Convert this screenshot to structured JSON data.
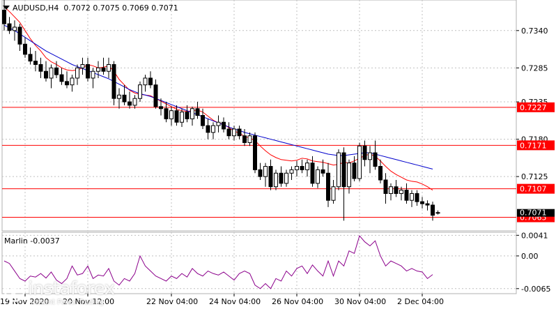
{
  "header": {
    "symbol": "AUDUSD,H4",
    "ohlc": "0.7072 0.7075 0.7069 0.7071"
  },
  "indicator": {
    "label": "Marlin -0.0037"
  },
  "logo": {
    "brand": "instaforex",
    "tagline": "Instant Forex Trading"
  },
  "colors": {
    "background": "#ffffff",
    "grid": "#c0c0c0",
    "level_line": "#ff0000",
    "ma_fast": "#ff0000",
    "ma_slow": "#0000cc",
    "oscillator": "#8b008b",
    "candle_bull": "#ffffff",
    "candle_bear": "#000000",
    "current_price_label": "#000000"
  },
  "chart_data": [
    {
      "type": "candlestick",
      "title": "AUDUSD,H4",
      "ylim": [
        0.7045,
        0.7385
      ],
      "y_ticks": [
        "0.7340",
        "0.7285",
        "0.7235",
        "0.7180",
        "0.7125"
      ],
      "x_ticks": [
        "19 Nov 2020",
        "20 Nov 12:00",
        "22 Nov 04:00",
        "24 Nov 04:00",
        "26 Nov 04:00",
        "30 Nov 04:00",
        "2 Dec 04:00"
      ],
      "grid": true,
      "levels": [
        {
          "value": 0.7227,
          "label": "0.7227"
        },
        {
          "value": 0.7171,
          "label": "0.7171"
        },
        {
          "value": 0.7107,
          "label": "0.7107"
        },
        {
          "value": 0.7065,
          "label": "0.7065"
        }
      ],
      "current_price": {
        "value": 0.7071,
        "label": "0.7071"
      },
      "candles": [
        [
          0.737,
          0.7385,
          0.734,
          0.735
        ],
        [
          0.735,
          0.736,
          0.7335,
          0.734
        ],
        [
          0.734,
          0.7355,
          0.7325,
          0.7345
        ],
        [
          0.7345,
          0.735,
          0.731,
          0.732
        ],
        [
          0.732,
          0.733,
          0.73,
          0.7305
        ],
        [
          0.7305,
          0.7315,
          0.729,
          0.7295
        ],
        [
          0.7295,
          0.731,
          0.728,
          0.729
        ],
        [
          0.729,
          0.73,
          0.727,
          0.728
        ],
        [
          0.728,
          0.7295,
          0.7265,
          0.727
        ],
        [
          0.727,
          0.729,
          0.7255,
          0.7285
        ],
        [
          0.7285,
          0.7295,
          0.727,
          0.7275
        ],
        [
          0.7275,
          0.7285,
          0.726,
          0.7265
        ],
        [
          0.7265,
          0.728,
          0.7255,
          0.726
        ],
        [
          0.726,
          0.7275,
          0.725,
          0.727
        ],
        [
          0.727,
          0.729,
          0.726,
          0.7285
        ],
        [
          0.7285,
          0.73,
          0.7275,
          0.729
        ],
        [
          0.729,
          0.73,
          0.7265,
          0.727
        ],
        [
          0.727,
          0.7285,
          0.7255,
          0.728
        ],
        [
          0.728,
          0.7295,
          0.727,
          0.7285
        ],
        [
          0.7285,
          0.73,
          0.7275,
          0.728
        ],
        [
          0.728,
          0.73,
          0.727,
          0.729
        ],
        [
          0.729,
          0.7295,
          0.723,
          0.724
        ],
        [
          0.724,
          0.7255,
          0.7225,
          0.7245
        ],
        [
          0.7245,
          0.726,
          0.723,
          0.7235
        ],
        [
          0.7235,
          0.725,
          0.7225,
          0.723
        ],
        [
          0.723,
          0.7245,
          0.7225,
          0.724
        ],
        [
          0.724,
          0.7265,
          0.7235,
          0.726
        ],
        [
          0.726,
          0.7275,
          0.725,
          0.727
        ],
        [
          0.727,
          0.728,
          0.7255,
          0.726
        ],
        [
          0.726,
          0.7268,
          0.7225,
          0.7228
        ],
        [
          0.7228,
          0.724,
          0.7215,
          0.7225
        ],
        [
          0.7225,
          0.7235,
          0.7205,
          0.721
        ],
        [
          0.721,
          0.7228,
          0.72,
          0.7222
        ],
        [
          0.7222,
          0.723,
          0.72,
          0.7205
        ],
        [
          0.7205,
          0.7225,
          0.7198,
          0.722
        ],
        [
          0.722,
          0.723,
          0.7205,
          0.721
        ],
        [
          0.721,
          0.7228,
          0.72,
          0.7225
        ],
        [
          0.7225,
          0.7235,
          0.721,
          0.7215
        ],
        [
          0.7215,
          0.7225,
          0.7195,
          0.72
        ],
        [
          0.72,
          0.721,
          0.718,
          0.719
        ],
        [
          0.719,
          0.7205,
          0.718,
          0.72
        ],
        [
          0.72,
          0.7215,
          0.719,
          0.7205
        ],
        [
          0.7205,
          0.7212,
          0.719,
          0.7195
        ],
        [
          0.7195,
          0.7205,
          0.718,
          0.7185
        ],
        [
          0.7185,
          0.72,
          0.7178,
          0.7195
        ],
        [
          0.7195,
          0.72,
          0.718,
          0.7185
        ],
        [
          0.7185,
          0.7195,
          0.717,
          0.7175
        ],
        [
          0.7175,
          0.719,
          0.717,
          0.7185
        ],
        [
          0.7185,
          0.719,
          0.713,
          0.7135
        ],
        [
          0.7135,
          0.7145,
          0.712,
          0.7125
        ],
        [
          0.7125,
          0.7145,
          0.711,
          0.714
        ],
        [
          0.714,
          0.715,
          0.7105,
          0.711
        ],
        [
          0.711,
          0.7135,
          0.7105,
          0.713
        ],
        [
          0.713,
          0.714,
          0.711,
          0.7115
        ],
        [
          0.7115,
          0.7135,
          0.711,
          0.713
        ],
        [
          0.713,
          0.714,
          0.712,
          0.7135
        ],
        [
          0.7135,
          0.7148,
          0.7125,
          0.714
        ],
        [
          0.714,
          0.715,
          0.713,
          0.7135
        ],
        [
          0.7135,
          0.715,
          0.7125,
          0.7145
        ],
        [
          0.7145,
          0.7155,
          0.711,
          0.7115
        ],
        [
          0.7115,
          0.714,
          0.7108,
          0.7135
        ],
        [
          0.7135,
          0.715,
          0.7125,
          0.713
        ],
        [
          0.713,
          0.7145,
          0.708,
          0.709
        ],
        [
          0.709,
          0.712,
          0.7085,
          0.711
        ],
        [
          0.711,
          0.7165,
          0.7105,
          0.716
        ],
        [
          0.716,
          0.7168,
          0.706,
          0.711
        ],
        [
          0.711,
          0.715,
          0.71,
          0.7145
        ],
        [
          0.7145,
          0.7155,
          0.7118,
          0.7122
        ],
        [
          0.7122,
          0.7175,
          0.7118,
          0.717
        ],
        [
          0.717,
          0.7178,
          0.714,
          0.715
        ],
        [
          0.715,
          0.717,
          0.713,
          0.716
        ],
        [
          0.716,
          0.7178,
          0.7135,
          0.714
        ],
        [
          0.714,
          0.715,
          0.7115,
          0.712
        ],
        [
          0.712,
          0.713,
          0.7085,
          0.71
        ],
        [
          0.71,
          0.7115,
          0.709,
          0.711
        ],
        [
          0.711,
          0.712,
          0.7095,
          0.71
        ],
        [
          0.71,
          0.711,
          0.709,
          0.7105
        ],
        [
          0.7105,
          0.7115,
          0.7085,
          0.709
        ],
        [
          0.709,
          0.7105,
          0.708,
          0.71
        ],
        [
          0.71,
          0.7105,
          0.7082,
          0.7088
        ],
        [
          0.7088,
          0.7095,
          0.7078,
          0.7085
        ],
        [
          0.7085,
          0.709,
          0.7075,
          0.7083
        ],
        [
          0.7083,
          0.7088,
          0.706,
          0.7068
        ],
        [
          0.7072,
          0.7075,
          0.7069,
          0.7071
        ]
      ],
      "series": [
        {
          "type": "line",
          "values": [
            0.7375,
            0.7368,
            0.736,
            0.7352,
            0.734,
            0.7328,
            0.7318,
            0.731,
            0.73,
            0.7294,
            0.729,
            0.7285,
            0.7282,
            0.7281,
            0.7282,
            0.7285,
            0.729,
            0.7288,
            0.7285,
            0.7286,
            0.7288,
            0.728,
            0.7268,
            0.726,
            0.7252,
            0.7248,
            0.7246,
            0.7245,
            0.7244,
            0.724,
            0.7236,
            0.7232,
            0.7228,
            0.7224,
            0.7222,
            0.7221,
            0.7222,
            0.7223,
            0.722,
            0.7214,
            0.7208,
            0.7204,
            0.7202,
            0.7197,
            0.7192,
            0.7189,
            0.7184,
            0.7182,
            0.7178,
            0.717,
            0.7163,
            0.7157,
            0.7153,
            0.715,
            0.7149,
            0.7148,
            0.7149,
            0.7152,
            0.7151,
            0.7148,
            0.7147,
            0.7146,
            0.7144,
            0.7142,
            0.7143,
            0.7146,
            0.7145,
            0.7148,
            0.7152,
            0.7156,
            0.7158,
            0.7155,
            0.7148,
            0.714,
            0.7133,
            0.7128,
            0.7124,
            0.712,
            0.7118,
            0.7117,
            0.7114,
            0.711,
            0.7105
          ]
        },
        {
          "type": "line",
          "values": [
            0.7348,
            0.7344,
            0.734,
            0.7335,
            0.733,
            0.7325,
            0.732,
            0.7315,
            0.731,
            0.7306,
            0.7302,
            0.7298,
            0.7294,
            0.729,
            0.7287,
            0.7284,
            0.7281,
            0.7278,
            0.7275,
            0.7272,
            0.7269,
            0.7265,
            0.7261,
            0.7257,
            0.7253,
            0.725,
            0.7247,
            0.7245,
            0.7243,
            0.724,
            0.7237,
            0.7234,
            0.7231,
            0.7228,
            0.7225,
            0.7222,
            0.7219,
            0.7216,
            0.7213,
            0.721,
            0.7207,
            0.7204,
            0.7201,
            0.7198,
            0.7195,
            0.7193,
            0.719,
            0.7188,
            0.7186,
            0.7184,
            0.7182,
            0.718,
            0.7178,
            0.7176,
            0.7174,
            0.7172,
            0.717,
            0.7168,
            0.7166,
            0.7164,
            0.7162,
            0.716,
            0.7158,
            0.7157,
            0.7156,
            0.7156,
            0.7157,
            0.7158,
            0.7159,
            0.716,
            0.716,
            0.7158,
            0.7156,
            0.7154,
            0.7152,
            0.715,
            0.7148,
            0.7146,
            0.7144,
            0.7142,
            0.714,
            0.7138,
            0.7136
          ]
        }
      ]
    },
    {
      "type": "line",
      "title": "Marlin -0.0037",
      "ylim": [
        -0.0075,
        0.0047
      ],
      "y_ticks": [
        "0.0041",
        "0.00",
        "-0.0065"
      ],
      "grid": true,
      "series": [
        {
          "values": [
            -0.001,
            -0.0015,
            -0.003,
            -0.0045,
            -0.005,
            -0.004,
            -0.0042,
            -0.0035,
            -0.0044,
            -0.0032,
            -0.0048,
            -0.0055,
            -0.0045,
            -0.002,
            -0.0038,
            -0.0035,
            -0.002,
            -0.0045,
            -0.0038,
            -0.004,
            -0.0025,
            -0.005,
            -0.0058,
            -0.0045,
            -0.005,
            -0.0035,
            0.0,
            -0.002,
            -0.003,
            -0.004,
            -0.0045,
            -0.005,
            -0.004,
            -0.0045,
            -0.0035,
            -0.0042,
            -0.0025,
            -0.0035,
            -0.004,
            -0.003,
            -0.0035,
            -0.0038,
            -0.0032,
            -0.004,
            -0.0048,
            -0.0035,
            -0.003,
            -0.0035,
            -0.0058,
            -0.0065,
            -0.0055,
            -0.0065,
            -0.0045,
            -0.005,
            -0.003,
            -0.004,
            -0.0025,
            -0.002,
            -0.0035,
            -0.0018,
            -0.003,
            -0.004,
            -0.001,
            -0.004,
            -0.001,
            -0.002,
            0.001,
            0.0005,
            0.004,
            0.0028,
            0.002,
            0.003,
            0.0,
            -0.002,
            -0.001,
            -0.0015,
            -0.002,
            -0.003,
            -0.0025,
            -0.003,
            -0.0032,
            -0.0045,
            -0.0037
          ]
        }
      ]
    }
  ]
}
